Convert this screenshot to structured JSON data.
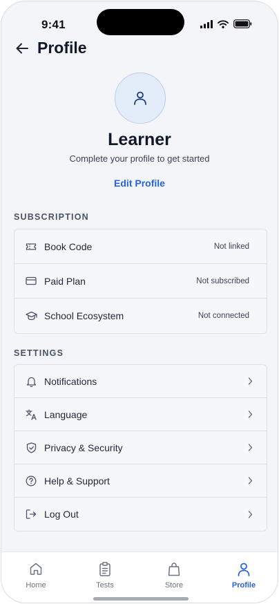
{
  "status_bar": {
    "time": "9:41"
  },
  "header": {
    "title": "Profile"
  },
  "profile": {
    "name": "Learner",
    "subtitle": "Complete your profile to get started",
    "edit_label": "Edit Profile"
  },
  "subscription": {
    "heading": "SUBSCRIPTION",
    "items": [
      {
        "label": "Book Code",
        "value": "Not linked",
        "icon": "ticket-icon"
      },
      {
        "label": "Paid Plan",
        "value": "Not subscribed",
        "icon": "credit-card-icon"
      },
      {
        "label": "School Ecosystem",
        "value": "Not connected",
        "icon": "graduation-cap-icon"
      }
    ]
  },
  "settings": {
    "heading": "SETTINGS",
    "items": [
      {
        "label": "Notifications",
        "icon": "bell-icon"
      },
      {
        "label": "Language",
        "icon": "translate-icon"
      },
      {
        "label": "Privacy & Security",
        "icon": "shield-icon"
      },
      {
        "label": "Help & Support",
        "icon": "help-circle-icon"
      },
      {
        "label": "Log Out",
        "icon": "logout-icon"
      }
    ]
  },
  "tabbar": {
    "tabs": [
      {
        "label": "Home",
        "icon": "home-icon",
        "active": false
      },
      {
        "label": "Tests",
        "icon": "clipboard-icon",
        "active": false
      },
      {
        "label": "Store",
        "icon": "shopping-bag-icon",
        "active": false
      },
      {
        "label": "Profile",
        "icon": "user-icon",
        "active": true
      }
    ]
  },
  "colors": {
    "accent": "#2563d9",
    "background": "#f3f5f9",
    "text": "#111827",
    "muted": "#6b7280"
  }
}
